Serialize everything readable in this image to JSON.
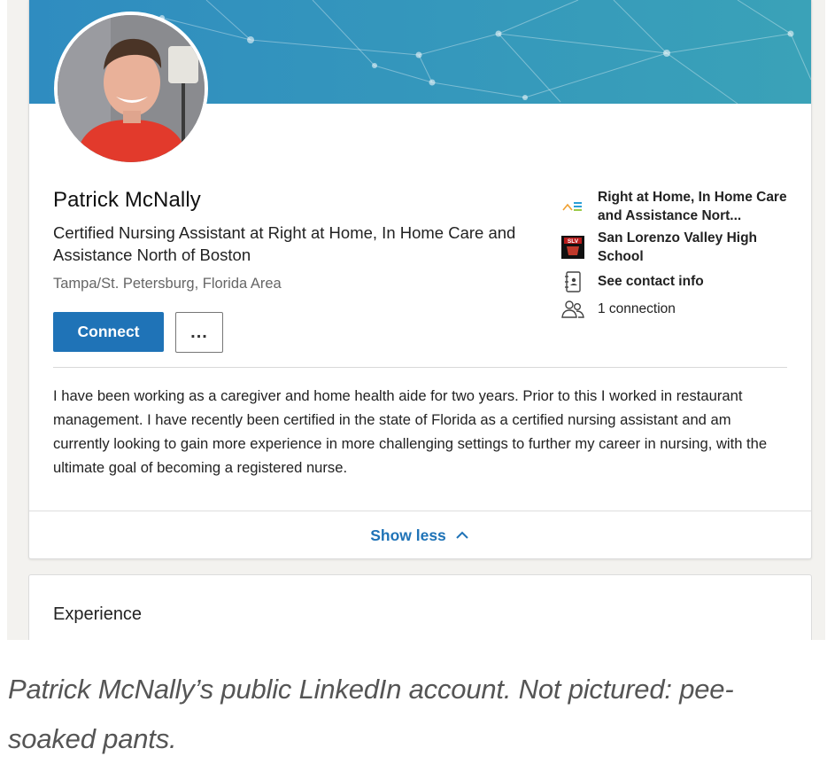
{
  "profile": {
    "name": "Patrick McNally",
    "headline": "Certified Nursing Assistant at Right at Home, In Home Care and Assistance North of Boston",
    "location": "Tampa/St. Petersburg, Florida Area",
    "connect_label": "Connect",
    "more_label": "...",
    "summary": "I have been working as a caregiver and home health aide for two years. Prior to this I worked in restaurant management. I have recently been certified in the state of Florida as a certified nursing assistant and am currently looking to gain more experience in more challenging settings to further my career in nursing, with the ultimate goal of becoming a registered nurse.",
    "show_less_label": "Show less"
  },
  "sidebar": {
    "company": "Right at Home, In Home Care and Assistance Nort...",
    "school": "San Lorenzo Valley High School",
    "school_logo_text": "SLV",
    "contact_info": "See contact info",
    "connections": "1 connection"
  },
  "experience": {
    "title": "Experience"
  },
  "caption": "Patrick McNally’s public LinkedIn account. Not pictured: pee-soaked pants.",
  "colors": {
    "accent": "#1f73b7",
    "banner_from": "#2a86b6",
    "banner_to": "#3fa3b6"
  },
  "icons": [
    "company-logo-icon",
    "school-logo-icon",
    "contact-card-icon",
    "connections-icon",
    "chevron-up-icon"
  ]
}
